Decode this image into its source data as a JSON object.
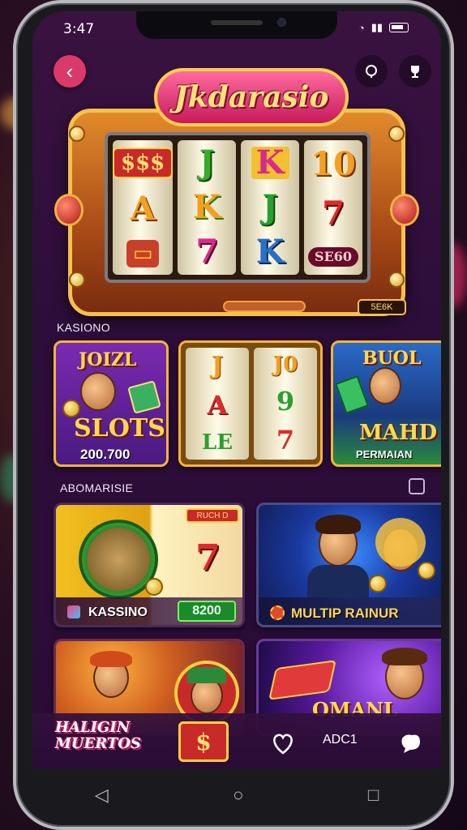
{
  "status_bar": {
    "time": "3:47"
  },
  "header": {
    "logo_text": "Jkdarasio",
    "back_label": "‹"
  },
  "slot_machine": {
    "reels": [
      [
        "$$$",
        "A",
        "▭"
      ],
      [
        "J",
        "K",
        "7"
      ],
      [
        "K",
        "J",
        "K"
      ],
      [
        "10",
        "7",
        "SE60"
      ]
    ],
    "bet_tag": "5E6K"
  },
  "sections": {
    "kasino_label": "KASIONO",
    "second_label": "ABOMARISIE"
  },
  "featured_cards": [
    {
      "title": "SLOTS",
      "subtitle": "JOIZL",
      "amount": "200.700"
    },
    {
      "reel_a": [
        "J",
        "A",
        "LE"
      ],
      "reel_b": [
        "J0",
        "9",
        "7"
      ]
    },
    {
      "title": "MAHD",
      "subtitle": "BUOL",
      "caption": "PERMAIAN"
    }
  ],
  "game_tiles": [
    {
      "label": "KASSINO",
      "tag": "RUCH D",
      "value": "8200",
      "symbol": "7"
    },
    {
      "label": "MULTIP RAINUR"
    },
    {
      "label": "HALIGIN MUERTOS",
      "symbol": "$"
    },
    {
      "label": "OMANL"
    }
  ],
  "bottom_nav": {
    "label": "ADC1"
  },
  "colors": {
    "accent": "#f2b536",
    "back_button": "#d93a6a",
    "background": "#2d0e3a"
  }
}
